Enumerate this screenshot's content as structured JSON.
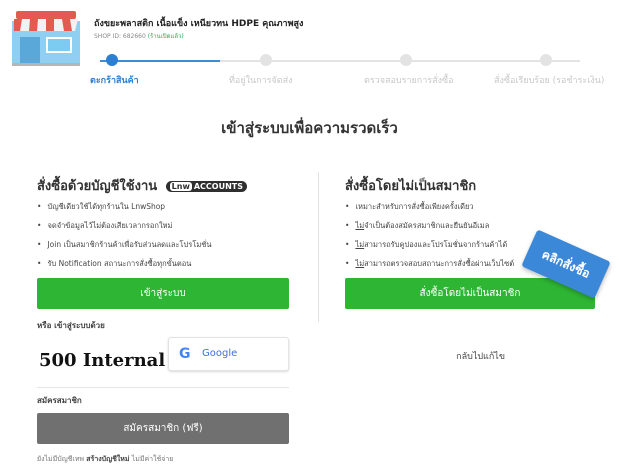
{
  "shop": {
    "name": "ถังขยะพลาสติก เนื้อแข็ง เหนียวทน HDPE คุณภาพสูง",
    "id_label": "SHOP ID: 682660",
    "status": "(ร้านเปิดแล้ว)"
  },
  "steps": [
    {
      "label": "ตะกร้าสินค้า",
      "active": true
    },
    {
      "label": "ที่อยู่ในการจัดส่ง",
      "active": false
    },
    {
      "label": "ตรวจสอบรายการสั่งซื้อ",
      "active": false
    },
    {
      "label": "สั่งซื้อเรียบร้อย (รอชำระเงิน)",
      "active": false
    }
  ],
  "page_title": "เข้าสู่ระบบเพื่อความรวดเร็ว",
  "member": {
    "title": "สั่งซื้อด้วยบัญชีใช้งาน",
    "badge_pre": "Lnw",
    "badge": "ACCOUNTS",
    "benefits": [
      "บัญชีเดียวใช้ได้ทุกร้านใน LnwShop",
      "จดจำข้อมูลไว้ไม่ต้องเสียเวลากรอกใหม่",
      "Join เป็นสมาชิกร้านค้าเพื่อรับส่วนลดและโปรโมชั่น",
      "รับ Notification สถานะการสั่งซื้อทุกขั้นตอน"
    ],
    "login_button": "เข้าสู่ระบบ",
    "or_login_with": "หรือ เข้าสู่ระบบด้วย",
    "error_text": "500 Internal",
    "google_label": "Google",
    "signup_heading": "สมัครสมาชิก",
    "signup_button": "สมัครสมาชิก (ฟรี)",
    "footnote_prefix": "ยังไม่มีบัญชีเทพ",
    "footnote_bold": "สร้างบัญชีใหม่",
    "footnote_suffix": "ไม่มีค่าใช้จ่าย"
  },
  "guest": {
    "title": "สั่งซื้อโดยไม่เป็นสมาชิก",
    "items": [
      {
        "lead": "",
        "text": "เหมาะสำหรับการสั่งซื้อเพียงครั้งเดียว"
      },
      {
        "lead": "ไม่",
        "text": "จำเป็นต้องสมัครสมาชิกและยืนยันอีเมล"
      },
      {
        "lead": "ไม่",
        "text": "สามารถรับคูปองและโปรโมชั่นจากร้านค้าได้"
      },
      {
        "lead": "ไม่",
        "text": "สามารถตรวจสอบสถานะการสั่งซื้อผ่านเว็บไซต์"
      }
    ],
    "button": "สั่งซื้อโดยไม่เป็นสมาชิก",
    "back_link": "กลับไปแก้ไข",
    "ribbon": "คลิกสั่งซื้อ"
  },
  "colors": {
    "accent_blue": "#2c7fd3",
    "button_green": "#2eb533",
    "button_gray": "#707070",
    "ribbon_blue": "#3b87d8"
  }
}
